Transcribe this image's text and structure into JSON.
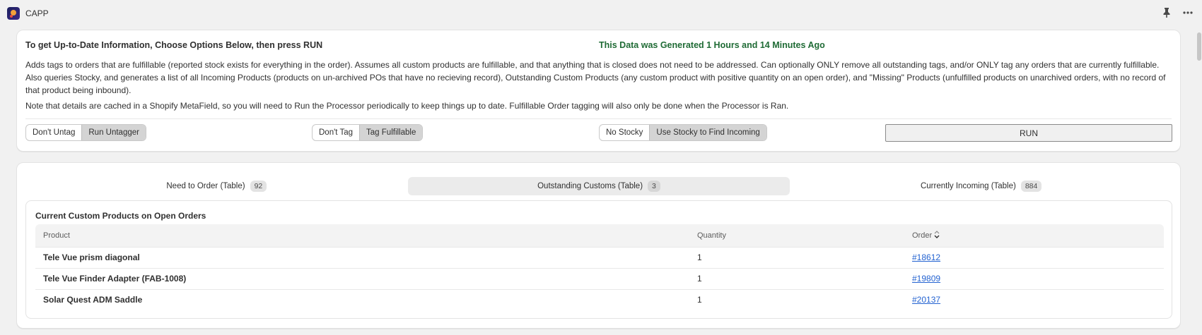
{
  "app": {
    "title": "CAPP"
  },
  "controls_card": {
    "heading": "To get Up-to-Date Information, Choose Options Below, then press RUN",
    "status": "This Data was Generated 1 Hours and 14 Minutes Ago",
    "description": "Adds tags to orders that are fulfillable (reported stock exists for everything in the order). Assumes all custom products are fulfillable, and that anything that is closed does not need to be addressed. Can optionally ONLY remove all outstanding tags, and/or ONLY tag any orders that are currently fulfillable. Also queries Stocky, and generates a list of all Incoming Products (products on un-archived POs that have no recieving record), Outstanding Custom Products (any custom product with positive quantity on an open order), and \"Missing\" Products (unfulfilled products on unarchived orders, with no record of that product being inbound).",
    "note": "Note that details are cached in a Shopify MetaField, so you will need to Run the Processor periodically to keep things up to date. Fulfillable Order tagging will also only be done when the Processor is Ran.",
    "untag_options": [
      "Don't Untag",
      "Run Untagger"
    ],
    "untag_selected": "Run Untagger",
    "tag_options": [
      "Don't Tag",
      "Tag Fulfillable"
    ],
    "tag_selected": "Tag Fulfillable",
    "stocky_options": [
      "No Stocky",
      "Use Stocky to Find Incoming"
    ],
    "stocky_selected": "Use Stocky to Find Incoming",
    "run_label": "RUN"
  },
  "tabs": [
    {
      "label": "Need to Order (Table)",
      "count": "92",
      "active": false
    },
    {
      "label": "Outstanding Customs (Table)",
      "count": "3",
      "active": true
    },
    {
      "label": "Currently Incoming (Table)",
      "count": "884",
      "active": false
    }
  ],
  "table": {
    "title": "Current Custom Products on Open Orders",
    "headers": {
      "product": "Product",
      "quantity": "Quantity",
      "order": "Order"
    },
    "rows": [
      {
        "product": "Tele Vue prism diagonal",
        "quantity": "1",
        "order": "#18612"
      },
      {
        "product": "Tele Vue Finder Adapter (FAB-1008)",
        "quantity": "1",
        "order": "#19809"
      },
      {
        "product": "Solar Quest ADM Saddle",
        "quantity": "1",
        "order": "#20137"
      }
    ]
  },
  "colors": {
    "status_green": "#1f6b35",
    "link_blue": "#2463d1",
    "active_segment": "#d4d4d4"
  },
  "icons": {
    "logo": "app-logo-icon",
    "pin": "pin-icon",
    "more": "more-icon",
    "sort": "sort-icon"
  }
}
